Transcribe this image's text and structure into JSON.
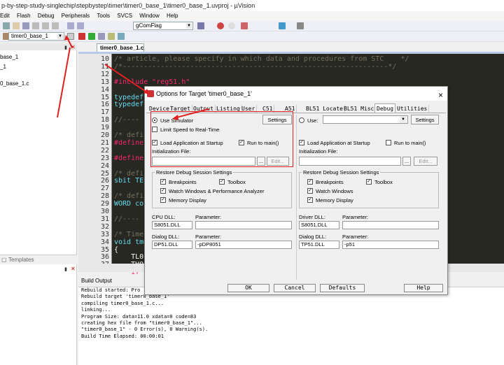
{
  "window": {
    "title": "p-by-step-study-singlechip\\stepbystep\\timer\\timer0_base_1\\timer0_base_1.uvproj - µVision"
  },
  "menu": [
    "Edit",
    "Flash",
    "Debug",
    "Peripherals",
    "Tools",
    "SVCS",
    "Window",
    "Help"
  ],
  "toolbar": {
    "target_select": "timer0_base_1",
    "find_combo": "gComFlag"
  },
  "left_panel": {
    "items": [
      "base_1",
      "_1",
      "0_base_1.c"
    ],
    "tab_templates": "Templates"
  },
  "editor": {
    "tab_label": "timer0_base_1.c",
    "line_numbers": [
      "10",
      "11",
      "12",
      "13",
      "14",
      "15",
      "16",
      "17",
      "18",
      "19",
      "20",
      "21",
      "22",
      "23",
      "24",
      "25",
      "26",
      "27",
      "28",
      "29",
      "30",
      "31",
      "32",
      "33",
      "34",
      "35",
      "36",
      "37"
    ],
    "lines": [
      "/* article, please specify in which data and procedures from STC    */",
      "/*---------------------------------------------------------------*/",
      "",
      "#include \"reg51.h\"",
      "",
      "typedef",
      "typedef",
      "",
      "//----",
      "",
      "/* defi",
      "#define",
      "",
      "#define",
      "",
      "/* defi",
      "sbit TES",
      "",
      "/* defi",
      "WORD cou",
      "",
      "//----",
      "",
      "/* Timer",
      "void tm0",
      "{",
      "    TL0",
      "    TH0"
    ],
    "extra_line": "    if ("
  },
  "build_output": {
    "header": "Build Output",
    "lines": [
      "Rebuild started: Pro",
      "Rebuild target 'timer0_base_1'",
      "compiling timer0_base_1.c...",
      "linking...",
      "Program Size: data=11.0 xdata=0 code=83",
      "creating hex file from \"timer0_base_1\"...",
      "\"timer0_base_1\" - 0 Error(s), 0 Warning(s).",
      "Build Time Elapsed:  00:00:01"
    ]
  },
  "dialog": {
    "title": "Options for Target 'timer0_base_1'",
    "close": "×",
    "tabs": [
      "Device",
      "Target",
      "Output",
      "Listing",
      "User",
      "C51",
      "A51",
      "BL51 Locate",
      "BL51 Misc",
      "Debug",
      "Utilities"
    ],
    "left": {
      "use_simulator": "Use Simulator",
      "settings": "Settings",
      "limit_speed": "Limit Speed to Real-Time",
      "load_app": "Load Application at Startup",
      "run_to_main": "Run to main()",
      "init_file": "Initialization File:",
      "browse": "...",
      "edit": "Edit...",
      "restore": "Restore Debug Session Settings",
      "breakpoints": "Breakpoints",
      "toolbox": "Toolbox",
      "watch_windows": "Watch Windows & Performance Analyzer",
      "memory_display": "Memory Display",
      "cpu_dll": "CPU DLL:",
      "cpu_param": "Parameter:",
      "cpu_dll_value": "S8051.DLL",
      "cpu_param_value": "",
      "dialog_dll": "Dialog DLL:",
      "dialog_param": "Parameter:",
      "dialog_dll_value": "DP51.DLL",
      "dialog_param_value": "-pDP8051"
    },
    "right": {
      "use": "Use:",
      "settings": "Settings",
      "load_app": "Load Application at Startup",
      "run_to_main": "Run to main()",
      "init_file": "Initialization File:",
      "browse": "...",
      "edit": "Edit...",
      "restore": "Restore Debug Session Settings",
      "breakpoints": "Breakpoints",
      "toolbox": "Toolbox",
      "watch_windows": "Watch Windows",
      "memory_display": "Memory Display",
      "driver_dll": "Driver DLL:",
      "driver_param": "Parameter:",
      "driver_dll_value": "S8051.DLL",
      "driver_param_value": "",
      "dialog_dll": "Dialog DLL:",
      "dialog_param": "Parameter:",
      "dialog_dll_value": "TP51.DLL",
      "dialog_param_value": "-p51"
    },
    "buttons": {
      "ok": "OK",
      "cancel": "Cancel",
      "defaults": "Defaults",
      "help": "Help"
    }
  },
  "colors": {
    "accent_red": "#e02020",
    "editor_bg": "#272822",
    "comment": "#75715e",
    "string": "#e6db74",
    "keyword": "#f92672",
    "type": "#66d9ef"
  }
}
